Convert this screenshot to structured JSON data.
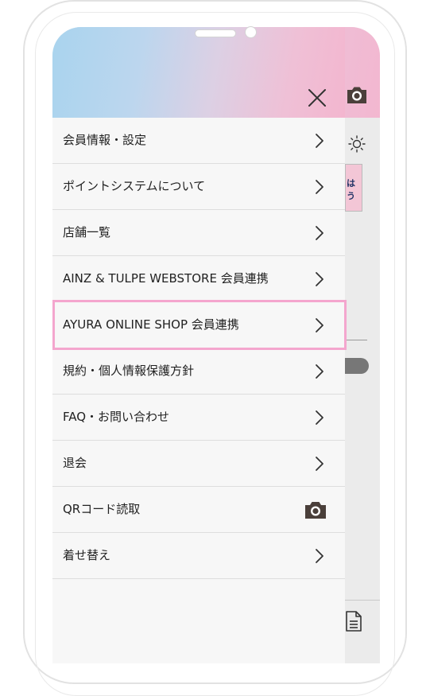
{
  "menu": {
    "items": [
      {
        "label": "会員情報・設定",
        "icon": "chevron-right-icon"
      },
      {
        "label": "ポイントシステムについて",
        "icon": "chevron-right-icon"
      },
      {
        "label": "店舗一覧",
        "icon": "chevron-right-icon"
      },
      {
        "label": "AINZ & TULPE WEBSTORE 会員連携",
        "icon": "chevron-right-icon"
      },
      {
        "label": "AYURA ONLINE SHOP 会員連携",
        "icon": "chevron-right-icon",
        "highlighted": true
      },
      {
        "label": "規約・個人情報保護方針",
        "icon": "chevron-right-icon"
      },
      {
        "label": "FAQ・お問い合わせ",
        "icon": "chevron-right-icon"
      },
      {
        "label": "退会",
        "icon": "chevron-right-icon"
      },
      {
        "label": "QRコード読取",
        "icon": "camera-icon"
      },
      {
        "label": "着せ替え",
        "icon": "chevron-right-icon"
      }
    ]
  },
  "background": {
    "badge_text": "は\nう"
  },
  "colors": {
    "highlight_border": "#f4a6ce",
    "header_gradient_start": "#a9d4ee",
    "header_gradient_end": "#f3b6cf",
    "camera_icon": "#4a3f3a"
  }
}
